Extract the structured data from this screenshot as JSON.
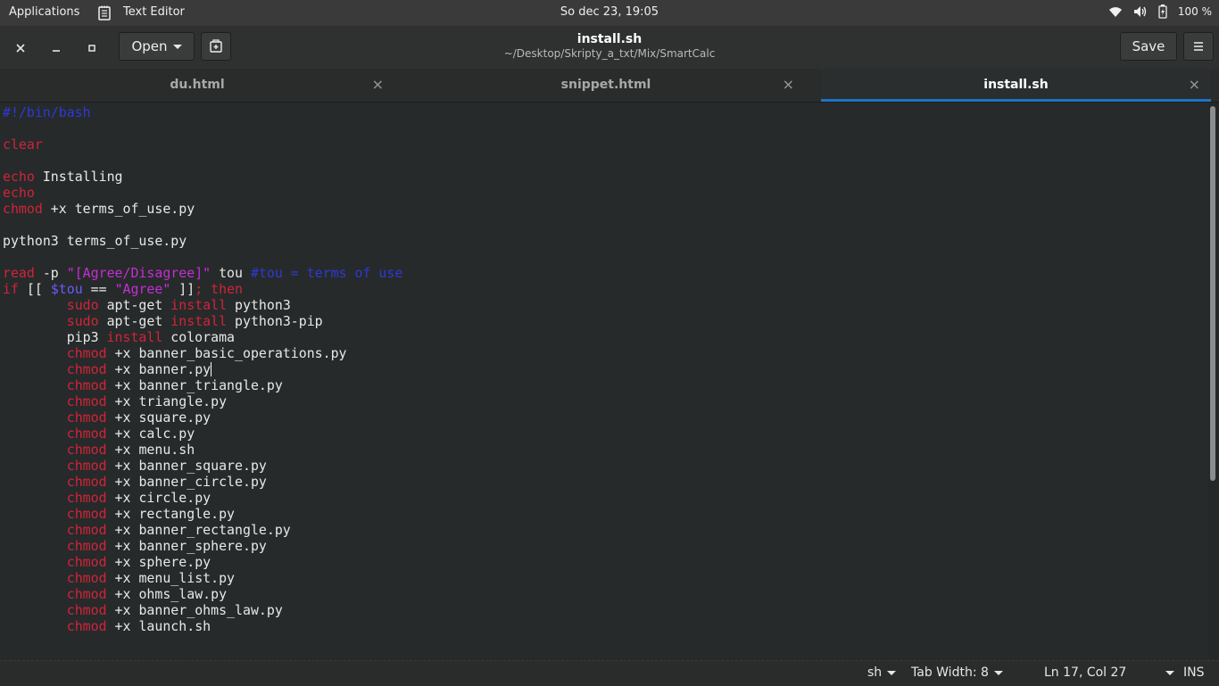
{
  "topbar": {
    "applications": "Applications",
    "app_name": "Text Editor",
    "clock": "So dec 23, 19:05",
    "battery": "100 %"
  },
  "header": {
    "open_label": "Open",
    "title": "install.sh",
    "subtitle": "~/Desktop/Skripty_a_txt/Mix/SmartCalc",
    "save_label": "Save"
  },
  "tabs": [
    {
      "label": "du.html"
    },
    {
      "label": "snippet.html"
    },
    {
      "label": "install.sh"
    }
  ],
  "code": {
    "shebang": "#!/bin/bash",
    "line_clear": "clear",
    "echo_installing": "Installing",
    "terms_file": "terms_of_use.py",
    "python_line": "python3 terms_of_use.py",
    "read_prompt": "\"[Agree/Disagree]\"",
    "read_comment": "#tou = terms of use",
    "agree_str": "\"Agree\"",
    "pkg_python3": "python3",
    "pkg_pip": "python3-pip",
    "pip_line_pkg": "colorama",
    "chmod_files": [
      "banner_basic_operations.py",
      "banner.py",
      "banner_triangle.py",
      "triangle.py",
      "square.py",
      "calc.py",
      "menu.sh",
      "banner_square.py",
      "banner_circle.py",
      "circle.py",
      "rectangle.py",
      "banner_rectangle.py",
      "banner_sphere.py",
      "sphere.py",
      "menu_list.py",
      "ohms_law.py",
      "banner_ohms_law.py",
      "launch.sh"
    ]
  },
  "status": {
    "language": "sh",
    "tab_width": "Tab Width: 8",
    "position": "Ln 17, Col 27",
    "mode": "INS"
  },
  "colors": {
    "keyword": "#d0243a",
    "string": "#c72cd8",
    "comment": "#2c3ad8",
    "accent": "#1d74c5"
  }
}
